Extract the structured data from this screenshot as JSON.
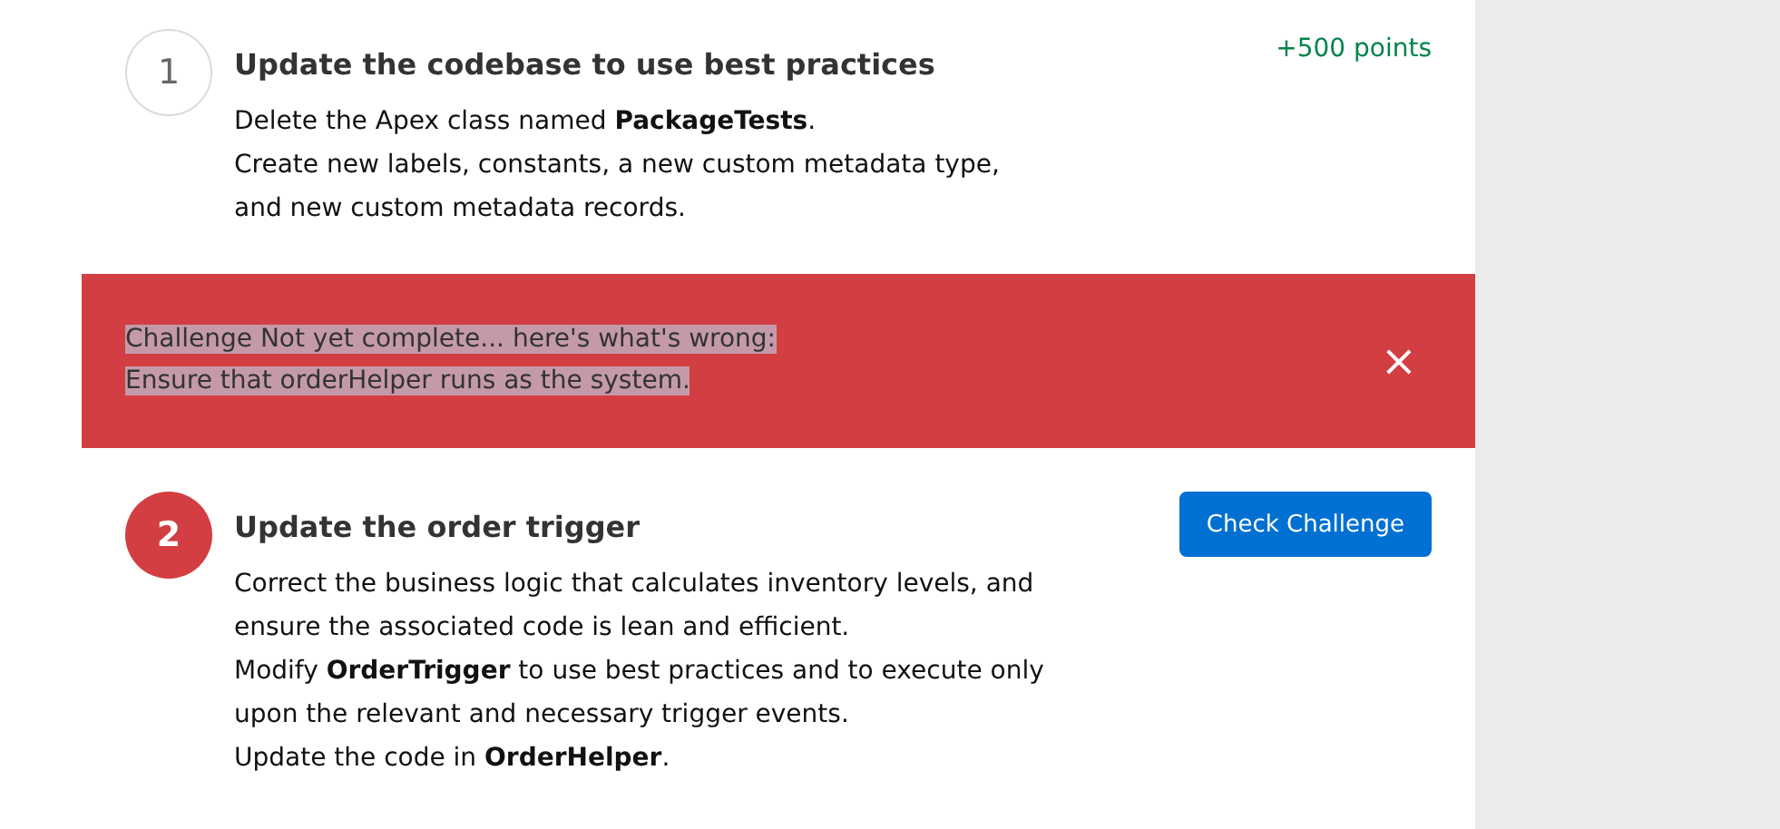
{
  "sections": [
    {
      "kind": "step",
      "number": "1",
      "failed": false,
      "title": "Update the codebase to use best practices",
      "points": "+500 points",
      "lines": [
        "Delete the Apex class named **PackageTests**.",
        "Create new labels, constants, a new custom metadata type,",
        "and new custom metadata records."
      ]
    },
    {
      "kind": "error_banner",
      "lines": [
        "Challenge Not yet complete... here's what's wrong:",
        "Ensure that orderHelper runs as the system."
      ],
      "close": "×"
    },
    {
      "kind": "step",
      "number": "2",
      "failed": true,
      "title": "Update the order trigger",
      "button": "Check Challenge",
      "lines": [
        "Correct the business logic that calculates inventory levels, and",
        "ensure the associated code is lean and efficient.",
        "Modify **OrderTrigger** to use best practices and to execute only",
        "upon the relevant and necessary trigger events.",
        "Update the code in **OrderHelper**."
      ]
    }
  ]
}
